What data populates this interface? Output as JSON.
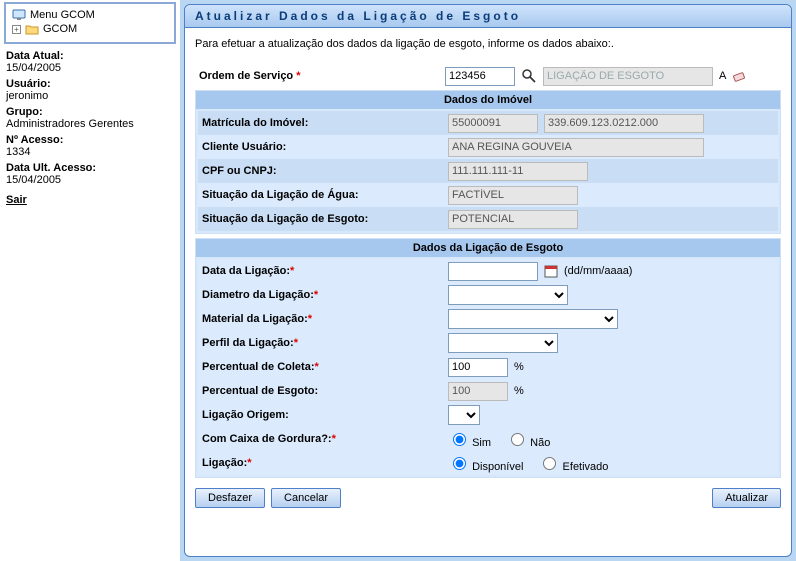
{
  "sidebar": {
    "tree": {
      "menu_label": "Menu GCOM",
      "root_label": "GCOM"
    },
    "info": {
      "date_label": "Data Atual:",
      "date_value": "15/04/2005",
      "user_label": "Usuário:",
      "user_value": "jeronimo",
      "group_label": "Grupo:",
      "group_value": "Administradores Gerentes",
      "access_no_label": "Nº Acesso:",
      "access_no_value": "1334",
      "last_access_label": "Data Ult. Acesso:",
      "last_access_value": "15/04/2005",
      "logout": "Sair"
    }
  },
  "panel": {
    "title": "Atualizar Dados da Ligação de Esgoto",
    "intro": "Para efetuar a atualização dos dados da ligação de esgoto, informe os dados abaixo:.",
    "order": {
      "label": "Ordem de Serviço",
      "value": "123456",
      "type_value": "LIGAÇÃO DE ESGOTO",
      "a": "A"
    },
    "imovel": {
      "section_title": "Dados do Imóvel",
      "matricula_label": "Matrícula do Imóvel:",
      "matricula_value": "55000091",
      "inscricao_value": "339.609.123.0212.000",
      "cliente_label": "Cliente Usuário:",
      "cliente_value": "ANA REGINA GOUVEIA",
      "cpf_label": "CPF ou CNPJ:",
      "cpf_value": "111.111.111-11",
      "agua_label": "Situação da Ligação de Água:",
      "agua_value": "FACTÍVEL",
      "esgoto_label": "Situação da Ligação de Esgoto:",
      "esgoto_value": "POTENCIAL"
    },
    "ligacao": {
      "section_title": "Dados da Ligação de Esgoto",
      "data_label": "Data da Ligação:",
      "data_value": "",
      "data_hint": "(dd/mm/aaaa)",
      "diametro_label": "Diametro da Ligação:",
      "material_label": "Material da Ligação:",
      "perfil_label": "Perfil da Ligação:",
      "coleta_label": "Percentual de Coleta:",
      "coleta_value": "100",
      "pct": "%",
      "esgoto_pct_label": "Percentual de Esgoto:",
      "esgoto_pct_value": "100",
      "origem_label": "Ligação Origem:",
      "gordura_label": "Com Caixa de Gordura?:",
      "sim": "Sim",
      "nao": "Não",
      "ligacao_label": "Ligação:",
      "disponivel": "Disponível",
      "efetivado": "Efetivado"
    },
    "buttons": {
      "undo": "Desfazer",
      "cancel": "Cancelar",
      "update": "Atualizar"
    }
  }
}
